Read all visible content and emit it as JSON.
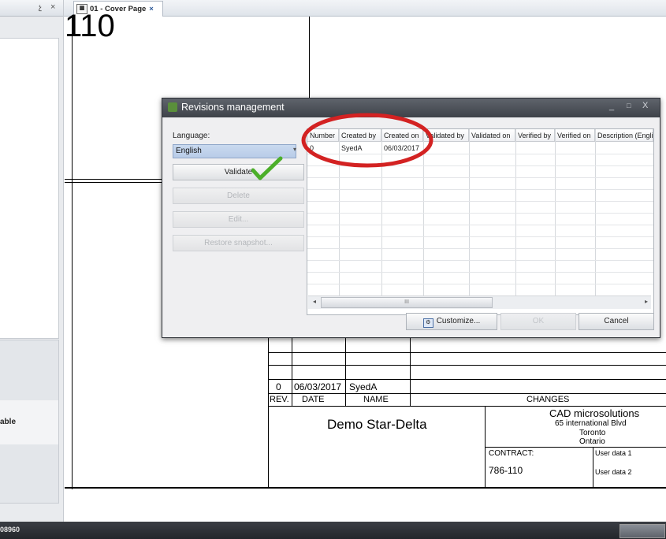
{
  "left_panel": {
    "pin_glyph": "չ",
    "close_glyph": "×",
    "bottom_label": "able"
  },
  "document_tab": {
    "title": "01 - Cover Page",
    "close_glyph": "×"
  },
  "drawing": {
    "sheet_number": "110",
    "revision_row": {
      "rev": "0",
      "date": "06/03/2017",
      "name": "SyedA"
    },
    "header_labels": {
      "rev": "REV.",
      "date": "DATE",
      "name": "NAME",
      "changes": "CHANGES"
    },
    "project_title": "Demo Star-Delta",
    "company": {
      "name": "CAD microsolutions",
      "address": "65 international Blvd",
      "city": "Toronto",
      "province": "Ontario"
    },
    "contract_label": "CONTRACT:",
    "contract_value": "786-110",
    "user_data_1": "User data 1",
    "user_data_2": "User data 2"
  },
  "status_bar": {
    "left_text": "08960"
  },
  "dialog": {
    "title": "Revisions management",
    "window_controls": {
      "minimize": "_",
      "maximize": "□",
      "close": "X"
    },
    "language_label": "Language:",
    "language_value": "English",
    "buttons": {
      "validate": "Validate",
      "delete": "Delete",
      "edit": "Edit...",
      "restore": "Restore snapshot..."
    },
    "grid": {
      "columns": [
        "Number",
        "Created by",
        "Created on",
        "Validated by",
        "Validated on",
        "Verified by",
        "Verified on",
        "Description (Engli"
      ],
      "rows": [
        {
          "number": "0",
          "created_by": "SyedA",
          "created_on": "06/03/2017"
        }
      ]
    },
    "footer": {
      "customize": "Customize...",
      "ok": "OK",
      "cancel": "Cancel"
    },
    "scroll_grip": "III",
    "colors": {
      "highlight": "#d32222",
      "check": "#4caf2a"
    }
  }
}
